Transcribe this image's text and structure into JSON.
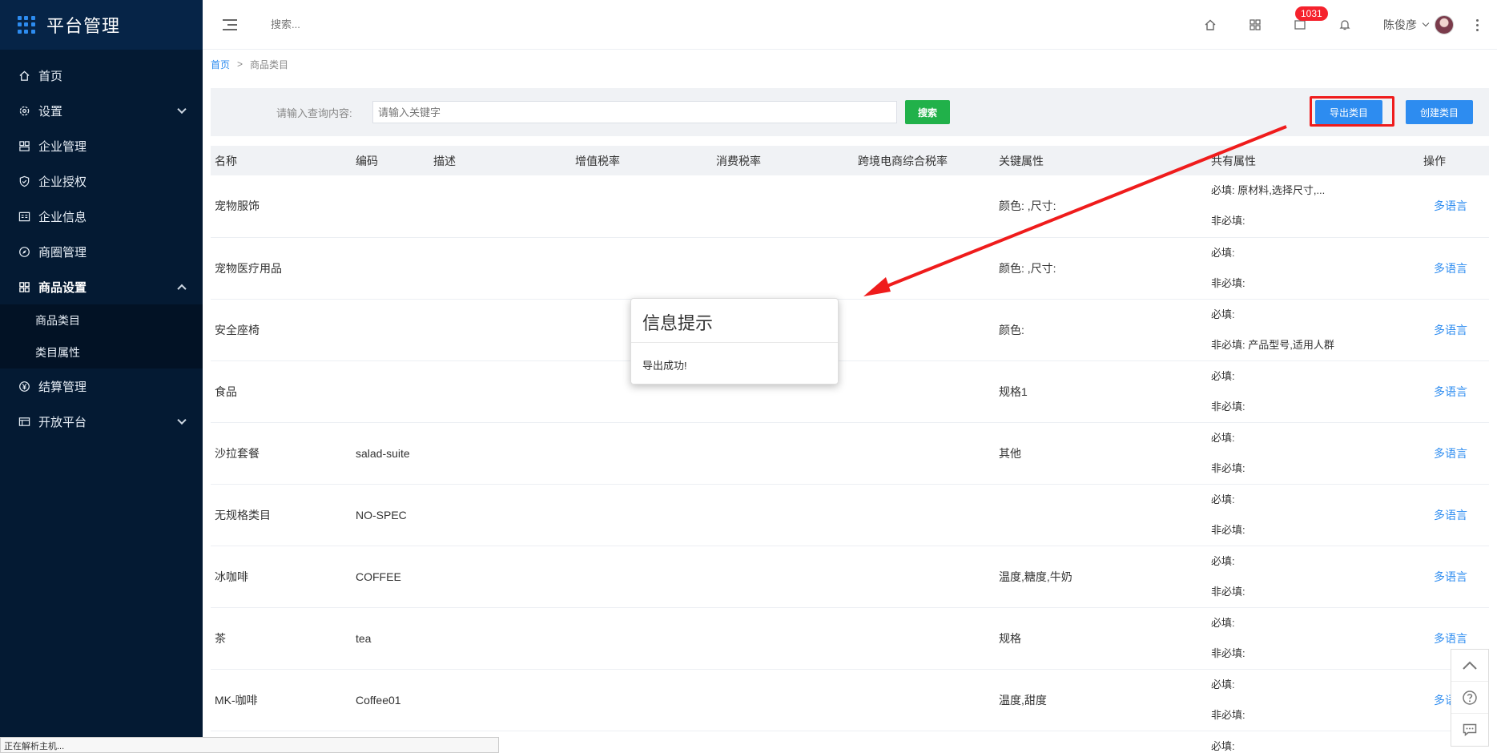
{
  "brand": {
    "title": "平台管理"
  },
  "sidebar": {
    "items": [
      {
        "label": "首页",
        "icon": "home-icon"
      },
      {
        "label": "设置",
        "icon": "gear-icon"
      },
      {
        "label": "企业管理",
        "icon": "enterprise-icon"
      },
      {
        "label": "企业授权",
        "icon": "shield-icon"
      },
      {
        "label": "企业信息",
        "icon": "document-icon"
      },
      {
        "label": "商圈管理",
        "icon": "compass-icon"
      },
      {
        "label": "商品设置",
        "icon": "grid-icon"
      },
      {
        "label": "结算管理",
        "icon": "yen-icon"
      },
      {
        "label": "开放平台",
        "icon": "platform-icon"
      }
    ],
    "submenu": [
      {
        "label": "商品类目"
      },
      {
        "label": "类目属性"
      }
    ]
  },
  "topbar": {
    "search_placeholder": "搜索...",
    "badge_count": "1031",
    "username": "陈俊彦"
  },
  "breadcrumb": {
    "home": "首页",
    "separator": ">",
    "current": "商品类目"
  },
  "filter": {
    "label": "请输入查询内容:",
    "placeholder": "请输入关键字",
    "search_label": "搜索",
    "export_label": "导出类目",
    "create_label": "创建类目"
  },
  "table": {
    "headers": [
      "名称",
      "编码",
      "描述",
      "增值税率",
      "消费税率",
      "跨境电商综合税率",
      "关键属性",
      "共有属性",
      "操作"
    ],
    "rows": [
      {
        "name": "宠物服饰",
        "code": "",
        "key_attr": "颜色: ,尺寸:",
        "required": "必填: 原材料,选择尺寸,...",
        "optional": "非必填:",
        "action": "多语言"
      },
      {
        "name": "宠物医疗用品",
        "code": "",
        "key_attr": "颜色: ,尺寸:",
        "required": "必填:",
        "optional": "非必填:",
        "action": "多语言"
      },
      {
        "name": "安全座椅",
        "code": "",
        "key_attr": "颜色:",
        "required": "必填:",
        "optional": "非必填: 产品型号,适用人群",
        "action": "多语言"
      },
      {
        "name": "食品",
        "code": "",
        "key_attr": "规格1",
        "required": "必填:",
        "optional": "非必填:",
        "action": "多语言"
      },
      {
        "name": "沙拉套餐",
        "code": "salad-suite",
        "key_attr": "其他",
        "required": "必填:",
        "optional": "非必填:",
        "action": "多语言"
      },
      {
        "name": "无规格类目",
        "code": "NO-SPEC",
        "key_attr": "",
        "required": "必填:",
        "optional": "非必填:",
        "action": "多语言"
      },
      {
        "name": "冰咖啡",
        "code": "COFFEE",
        "key_attr": "温度,糖度,牛奶",
        "required": "必填:",
        "optional": "非必填:",
        "action": "多语言"
      },
      {
        "name": "茶",
        "code": "tea",
        "key_attr": "规格",
        "required": "必填:",
        "optional": "非必填:",
        "action": "多语言"
      },
      {
        "name": "MK-咖啡",
        "code": "Coffee01",
        "key_attr": "温度,甜度",
        "required": "必填:",
        "optional": "非必填:",
        "action": "多语言"
      }
    ],
    "partial_row_required": "必填:"
  },
  "modal": {
    "title": "信息提示",
    "message": "导出成功!"
  },
  "statusbar": {
    "text": "正在解析主机..."
  },
  "colors": {
    "primary": "#2d8cf0",
    "success": "#21b14a",
    "sidebar": "#041a33",
    "annotation": "#ef1c1c"
  }
}
